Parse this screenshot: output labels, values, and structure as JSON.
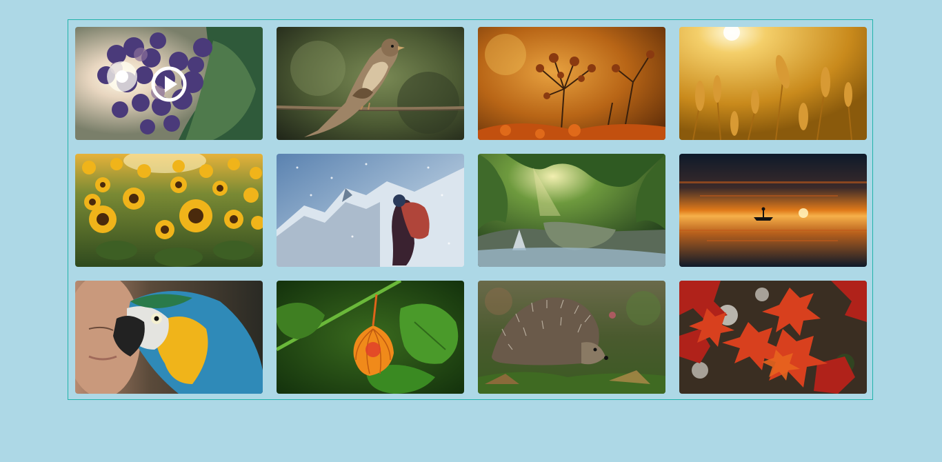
{
  "gallery": {
    "items": [
      {
        "subject": "grapes",
        "media": "video",
        "icon": "play-icon"
      },
      {
        "subject": "sparrow",
        "media": "image"
      },
      {
        "subject": "wildflower",
        "media": "image"
      },
      {
        "subject": "wheat",
        "media": "image"
      },
      {
        "subject": "sunflowers",
        "media": "image"
      },
      {
        "subject": "mountain-hiker",
        "media": "image"
      },
      {
        "subject": "forest-waterfall",
        "media": "image"
      },
      {
        "subject": "sunset-lake-boat",
        "media": "image"
      },
      {
        "subject": "macaw",
        "media": "image"
      },
      {
        "subject": "physalis",
        "media": "image"
      },
      {
        "subject": "hedgehog",
        "media": "image"
      },
      {
        "subject": "autumn-maple-leaves",
        "media": "image"
      }
    ]
  },
  "colors": {
    "page_background": "#add8e6",
    "gallery_border": "#20b2aa"
  }
}
